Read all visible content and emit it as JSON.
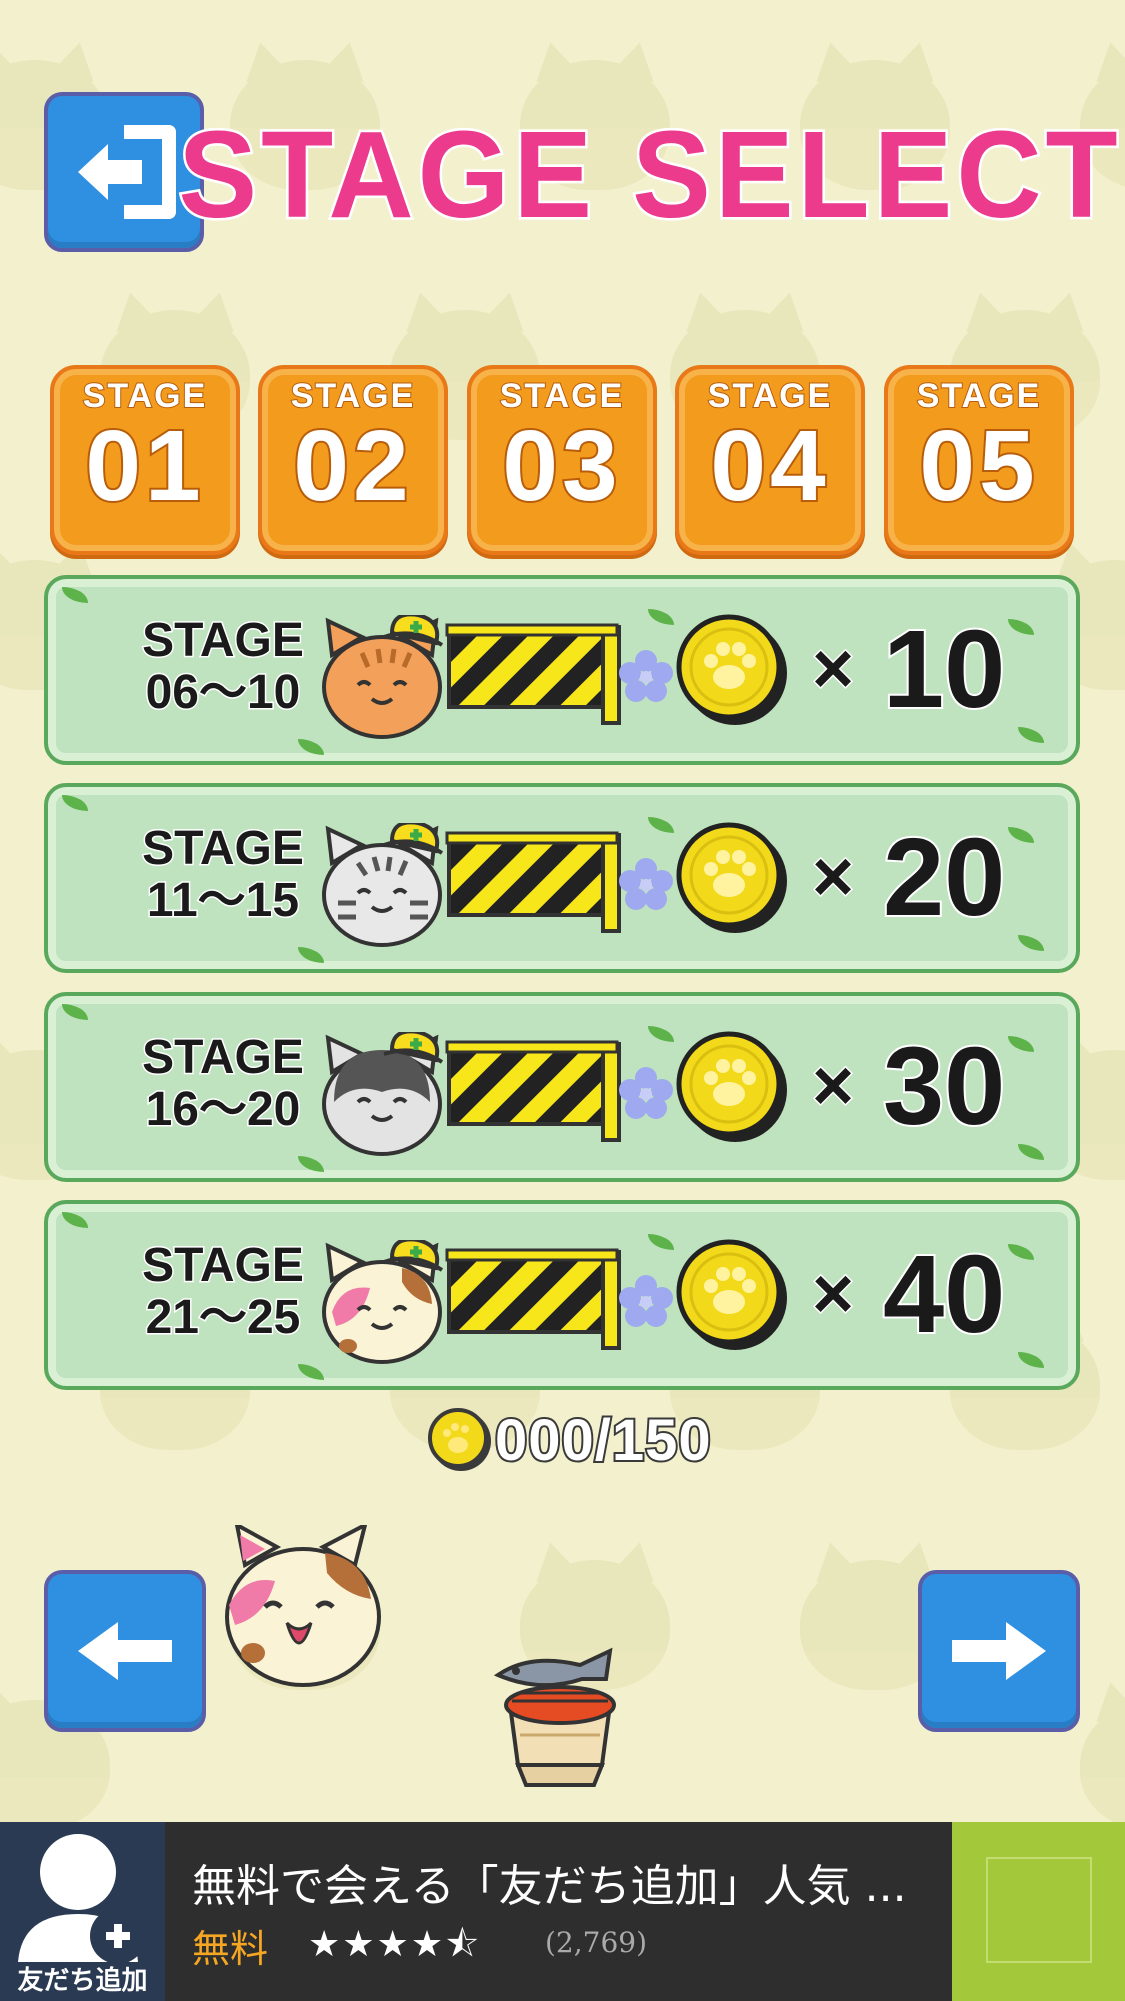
{
  "header": {
    "back_button": "exit-icon",
    "title_left": "STAGE",
    "title_right": "SELECT",
    "paw_icon": "paw-icon"
  },
  "unlocked_stages": [
    {
      "label": "STAGE",
      "number": "01"
    },
    {
      "label": "STAGE",
      "number": "02"
    },
    {
      "label": "STAGE",
      "number": "03"
    },
    {
      "label": "STAGE",
      "number": "04"
    },
    {
      "label": "STAGE",
      "number": "05"
    }
  ],
  "locked_groups": [
    {
      "label": "STAGE",
      "range": "06〜10",
      "times": "×",
      "cost": "10",
      "cat_color": "#f3a15a",
      "cat_type": "orange-tabby"
    },
    {
      "label": "STAGE",
      "range": "11〜15",
      "times": "×",
      "cost": "20",
      "cat_color": "#e8e8e8",
      "cat_type": "silver-tabby"
    },
    {
      "label": "STAGE",
      "range": "16〜20",
      "times": "×",
      "cost": "30",
      "cat_color": "#e3e3e3",
      "cat_type": "tuxedo"
    },
    {
      "label": "STAGE",
      "range": "21〜25",
      "times": "×",
      "cost": "40",
      "cat_color": "#fbf3d6",
      "cat_type": "calico"
    }
  ],
  "coin_counter": {
    "text": "000/150",
    "icon": "coin-icon"
  },
  "nav": {
    "prev": "arrow-left-icon",
    "next": "arrow-right-icon"
  },
  "ad": {
    "icon_caption": "友だち追加",
    "title": "無料で会える「友だち追加」人気 ...",
    "price": "無料",
    "stars": "★★★★⯪",
    "rating": 4.5,
    "reviews": "(2,769)"
  },
  "colors": {
    "background": "#f3f0cd",
    "title_pink": "#ec3a8c",
    "tile_orange": "#f29b1c",
    "row_green": "#bfe2bf",
    "button_blue": "#2f8fe0",
    "coin_gold": "#f2d91a",
    "ad_green": "#a3c83a"
  }
}
